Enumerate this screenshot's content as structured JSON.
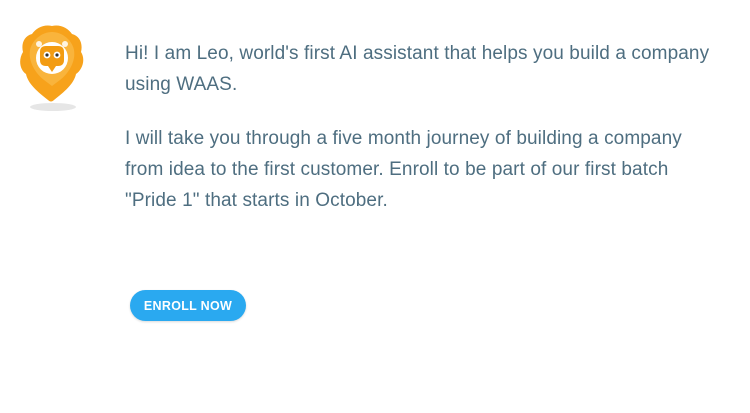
{
  "assistant": {
    "avatar_icon": "lion-mascot-icon",
    "brand_color": "#f5a623"
  },
  "message": {
    "paragraph_1": "Hi! I am Leo, world's first AI assistant that helps you build a company using WAAS.",
    "paragraph_2": "I will take you through a five month journey of building a company from idea to the first customer. Enroll to be part of our first batch \"Pride 1\" that starts in October."
  },
  "cta": {
    "label": "ENROLL NOW",
    "color": "#2aa9f0"
  }
}
